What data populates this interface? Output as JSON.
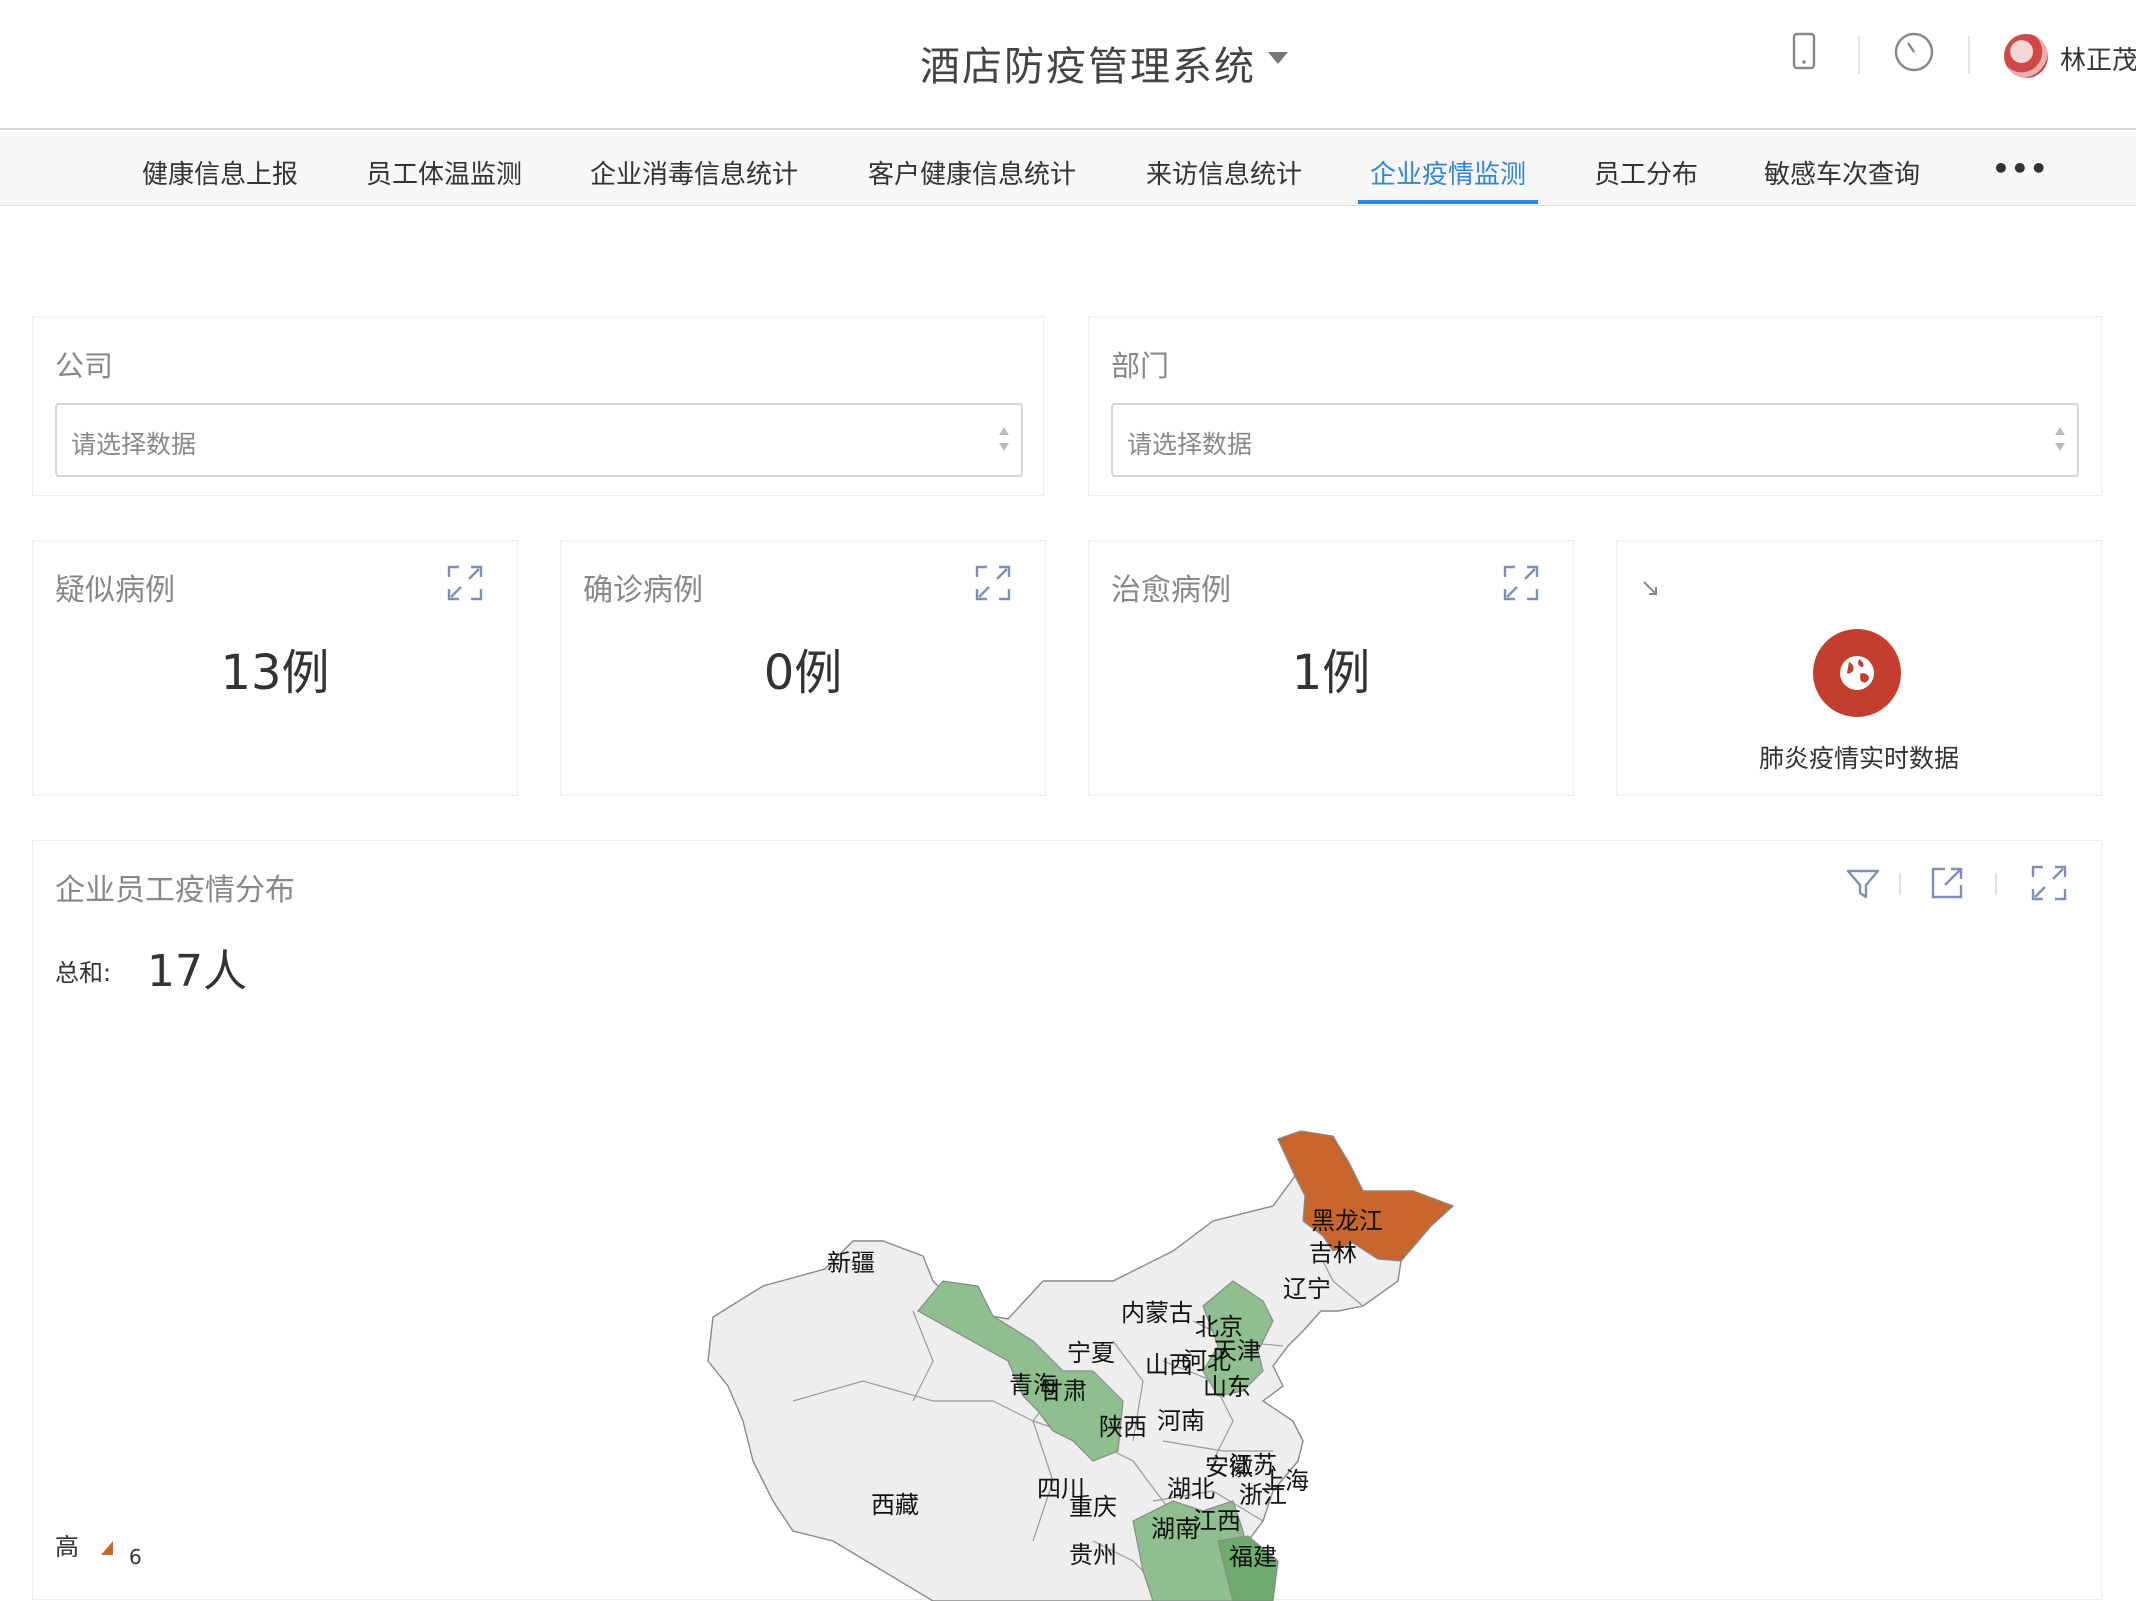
{
  "header": {
    "app_title": "酒店防疫管理系统",
    "user_name": "林正茂",
    "icons": [
      "mobile-icon",
      "compass-icon"
    ]
  },
  "nav": {
    "items": [
      {
        "label": "健康信息上报",
        "active": false
      },
      {
        "label": "员工体温监测",
        "active": false
      },
      {
        "label": "企业消毒信息统计",
        "active": false
      },
      {
        "label": "客户健康信息统计",
        "active": false
      },
      {
        "label": "来访信息统计",
        "active": false
      },
      {
        "label": "企业疫情监测",
        "active": true
      },
      {
        "label": "员工分布",
        "active": false
      },
      {
        "label": "敏感车次查询",
        "active": false
      }
    ],
    "more": "•••"
  },
  "filters": {
    "company": {
      "label": "公司",
      "placeholder": "请选择数据"
    },
    "department": {
      "label": "部门",
      "placeholder": "请选择数据"
    }
  },
  "stats": [
    {
      "label": "疑似病例",
      "value": "13例"
    },
    {
      "label": "确诊病例",
      "value": "0例"
    },
    {
      "label": "治愈病例",
      "value": "1例"
    }
  ],
  "realtime": {
    "label": "肺炎疫情实时数据",
    "icon": "globe-icon"
  },
  "map": {
    "title": "企业员工疫情分布",
    "sum_label": "总和:",
    "sum_value": "17人",
    "legend_high": "高",
    "legend_value": "6",
    "colors": {
      "high": "#c8662e",
      "mid": "#8fbf8f",
      "none": "#eeeeee",
      "border": "#8a8a8a"
    },
    "provinces": [
      {
        "name": "黑龙江",
        "level": "high"
      },
      {
        "name": "吉林",
        "level": "none"
      },
      {
        "name": "辽宁",
        "level": "none"
      },
      {
        "name": "新疆",
        "level": "none"
      },
      {
        "name": "内蒙古",
        "level": "none"
      },
      {
        "name": "北京",
        "level": "mid"
      },
      {
        "name": "天津",
        "level": "none"
      },
      {
        "name": "河北",
        "level": "mid"
      },
      {
        "name": "山西",
        "level": "none"
      },
      {
        "name": "宁夏",
        "level": "none"
      },
      {
        "name": "青海",
        "level": "none"
      },
      {
        "name": "甘肃",
        "level": "mid"
      },
      {
        "name": "山东",
        "level": "none"
      },
      {
        "name": "陕西",
        "level": "none"
      },
      {
        "name": "河南",
        "level": "none"
      },
      {
        "name": "江苏",
        "level": "none"
      },
      {
        "name": "安徽",
        "level": "none"
      },
      {
        "name": "上海",
        "level": "none"
      },
      {
        "name": "西藏",
        "level": "none"
      },
      {
        "name": "四川",
        "level": "none"
      },
      {
        "name": "湖北",
        "level": "none"
      },
      {
        "name": "浙江",
        "level": "none"
      },
      {
        "name": "重庆",
        "level": "none"
      },
      {
        "name": "湖南",
        "level": "mid"
      },
      {
        "name": "江西",
        "level": "mid"
      },
      {
        "name": "贵州",
        "level": "none"
      },
      {
        "name": "福建",
        "level": "none"
      }
    ]
  }
}
